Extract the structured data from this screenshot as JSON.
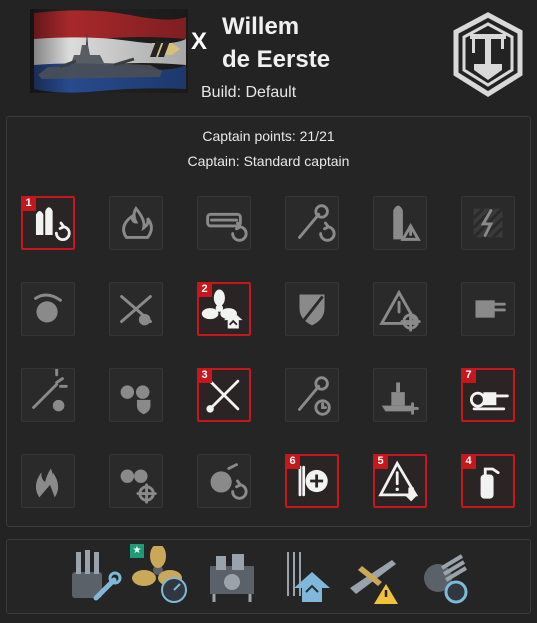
{
  "header": {
    "tier": "X",
    "ship_name_line1": "Willem",
    "ship_name_line2": "de Eerste",
    "build": "Build: Default",
    "nation_icon": "netherlands-crane-emblem",
    "flag_icon": "dutch-flag-battleship"
  },
  "captain": {
    "points": "Captain points: 21/21",
    "name": "Captain: Standard captain"
  },
  "colors": {
    "selected_border": "#c8161d",
    "badge": "#c8161d",
    "star": "#1e9b77"
  },
  "skills": [
    {
      "icon": "shells-reload-icon",
      "selected": true,
      "order": "1"
    },
    {
      "icon": "fire-icon",
      "selected": false,
      "order": ""
    },
    {
      "icon": "consumable-reload-icon",
      "selected": false,
      "order": ""
    },
    {
      "icon": "wrench-reload-icon",
      "selected": false,
      "order": ""
    },
    {
      "icon": "shell-warning-icon",
      "selected": false,
      "order": ""
    },
    {
      "icon": "lightning-striped-icon",
      "selected": false,
      "order": ""
    },
    {
      "icon": "turret-rotate-icon",
      "selected": false,
      "order": ""
    },
    {
      "icon": "aa-crossed-icon",
      "selected": false,
      "order": ""
    },
    {
      "icon": "propeller-up-icon",
      "selected": true,
      "order": "2"
    },
    {
      "icon": "shield-sword-icon",
      "selected": false,
      "order": ""
    },
    {
      "icon": "warning-target-icon",
      "selected": false,
      "order": ""
    },
    {
      "icon": "secondary-gun-icon",
      "selected": false,
      "order": ""
    },
    {
      "icon": "aa-burst-icon",
      "selected": false,
      "order": ""
    },
    {
      "icon": "turrets-shield-icon",
      "selected": false,
      "order": ""
    },
    {
      "icon": "crossed-tools-icon",
      "selected": true,
      "order": "3"
    },
    {
      "icon": "wrench-timer-icon",
      "selected": false,
      "order": ""
    },
    {
      "icon": "ship-plus-icon",
      "selected": false,
      "order": ""
    },
    {
      "icon": "gun-mount-icon",
      "selected": true,
      "order": "7"
    },
    {
      "icon": "flames-icon",
      "selected": false,
      "order": ""
    },
    {
      "icon": "turrets-target-icon",
      "selected": false,
      "order": ""
    },
    {
      "icon": "turret-reload-icon",
      "selected": false,
      "order": ""
    },
    {
      "icon": "heal-plus-icon",
      "selected": true,
      "order": "6"
    },
    {
      "icon": "warning-down-icon",
      "selected": true,
      "order": "5"
    },
    {
      "icon": "extinguisher-icon",
      "selected": true,
      "order": "4"
    }
  ],
  "upgrades": [
    {
      "icon": "guns-wrench-upgrade-icon",
      "starred": false
    },
    {
      "icon": "propeller-gauge-upgrade-icon",
      "starred": true,
      "star": "★"
    },
    {
      "icon": "engine-room-upgrade-icon",
      "starred": false
    },
    {
      "icon": "arrows-up-upgrade-icon",
      "starred": false
    },
    {
      "icon": "plane-warning-upgrade-icon",
      "starred": false
    },
    {
      "icon": "turret-reload-upgrade-icon",
      "starred": false
    }
  ]
}
